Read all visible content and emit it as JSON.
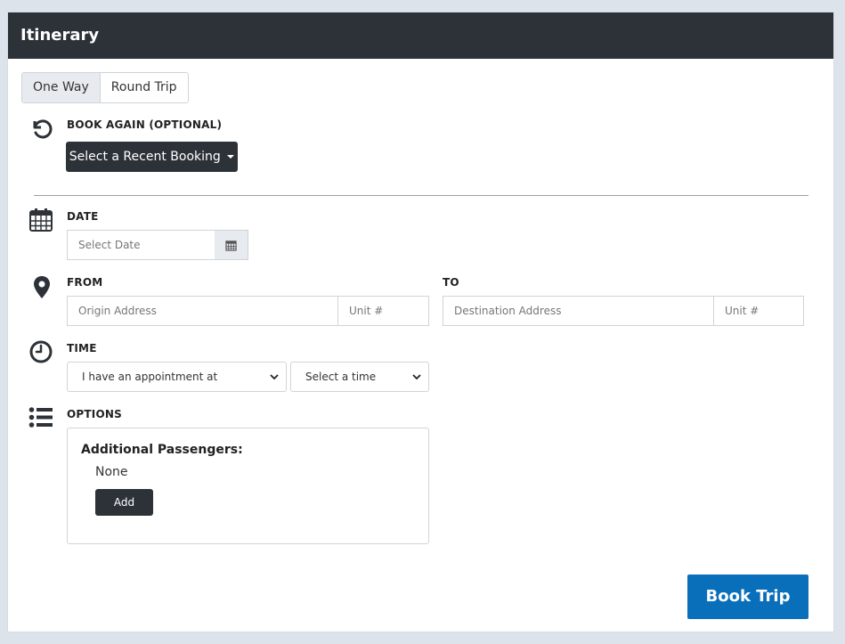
{
  "header": {
    "title": "Itinerary"
  },
  "trip_type": {
    "options": [
      "One Way",
      "Round Trip"
    ],
    "selected": "One Way"
  },
  "book_again": {
    "label": "BOOK AGAIN (OPTIONAL)",
    "button_label": "Select a Recent Booking",
    "icon": "history-icon"
  },
  "date": {
    "label": "DATE",
    "placeholder": "Select Date",
    "icon": "calendar-icon"
  },
  "from": {
    "label": "FROM",
    "address_placeholder": "Origin Address",
    "unit_placeholder": "Unit #",
    "icon": "map-pin-icon"
  },
  "to": {
    "label": "TO",
    "address_placeholder": "Destination Address",
    "unit_placeholder": "Unit #"
  },
  "time": {
    "label": "TIME",
    "mode_selected": "I have an appointment at",
    "time_selected": "Select a time",
    "icon": "clock-icon"
  },
  "options": {
    "label": "OPTIONS",
    "icon": "list-icon",
    "passengers_title": "Additional Passengers:",
    "passengers_value": "None",
    "add_label": "Add"
  },
  "submit": {
    "label": "Book Trip"
  },
  "colors": {
    "header_bg": "#2d3239",
    "primary": "#0a6fba",
    "panel_bg": "#ffffff",
    "page_bg": "#dde3ea"
  }
}
